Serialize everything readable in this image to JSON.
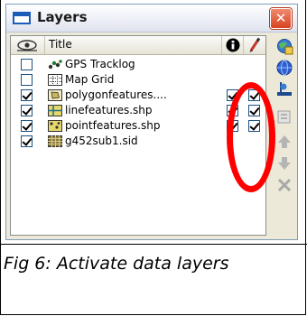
{
  "window": {
    "title": "Layers",
    "close_glyph": "✕"
  },
  "table": {
    "header_title": "Title",
    "rows": [
      {
        "label": "GPS Tracklog",
        "visible": false,
        "info": false,
        "edit": false,
        "icon": "gps-tracklog-icon"
      },
      {
        "label": "Map Grid",
        "visible": false,
        "info": false,
        "edit": false,
        "icon": "map-grid-icon"
      },
      {
        "label": "polygonfeatures....",
        "visible": true,
        "info": true,
        "edit": true,
        "icon": "polygon-layer-icon"
      },
      {
        "label": "linefeatures.shp",
        "visible": true,
        "info": true,
        "edit": true,
        "icon": "line-layer-icon"
      },
      {
        "label": "pointfeatures.shp",
        "visible": true,
        "info": true,
        "edit": true,
        "icon": "point-layer-icon"
      },
      {
        "label": "g452sub1.sid",
        "visible": true,
        "info": false,
        "edit": false,
        "icon": "raster-layer-icon"
      }
    ]
  },
  "toolbar": [
    "add-layer-icon",
    "globe-icon",
    "zoom-to-layer-icon",
    "properties-icon",
    "move-up-icon",
    "move-down-icon",
    "remove-layer-icon"
  ],
  "annotation": {
    "color": "#ff0000"
  },
  "caption": "Fig 6: Activate data layers"
}
